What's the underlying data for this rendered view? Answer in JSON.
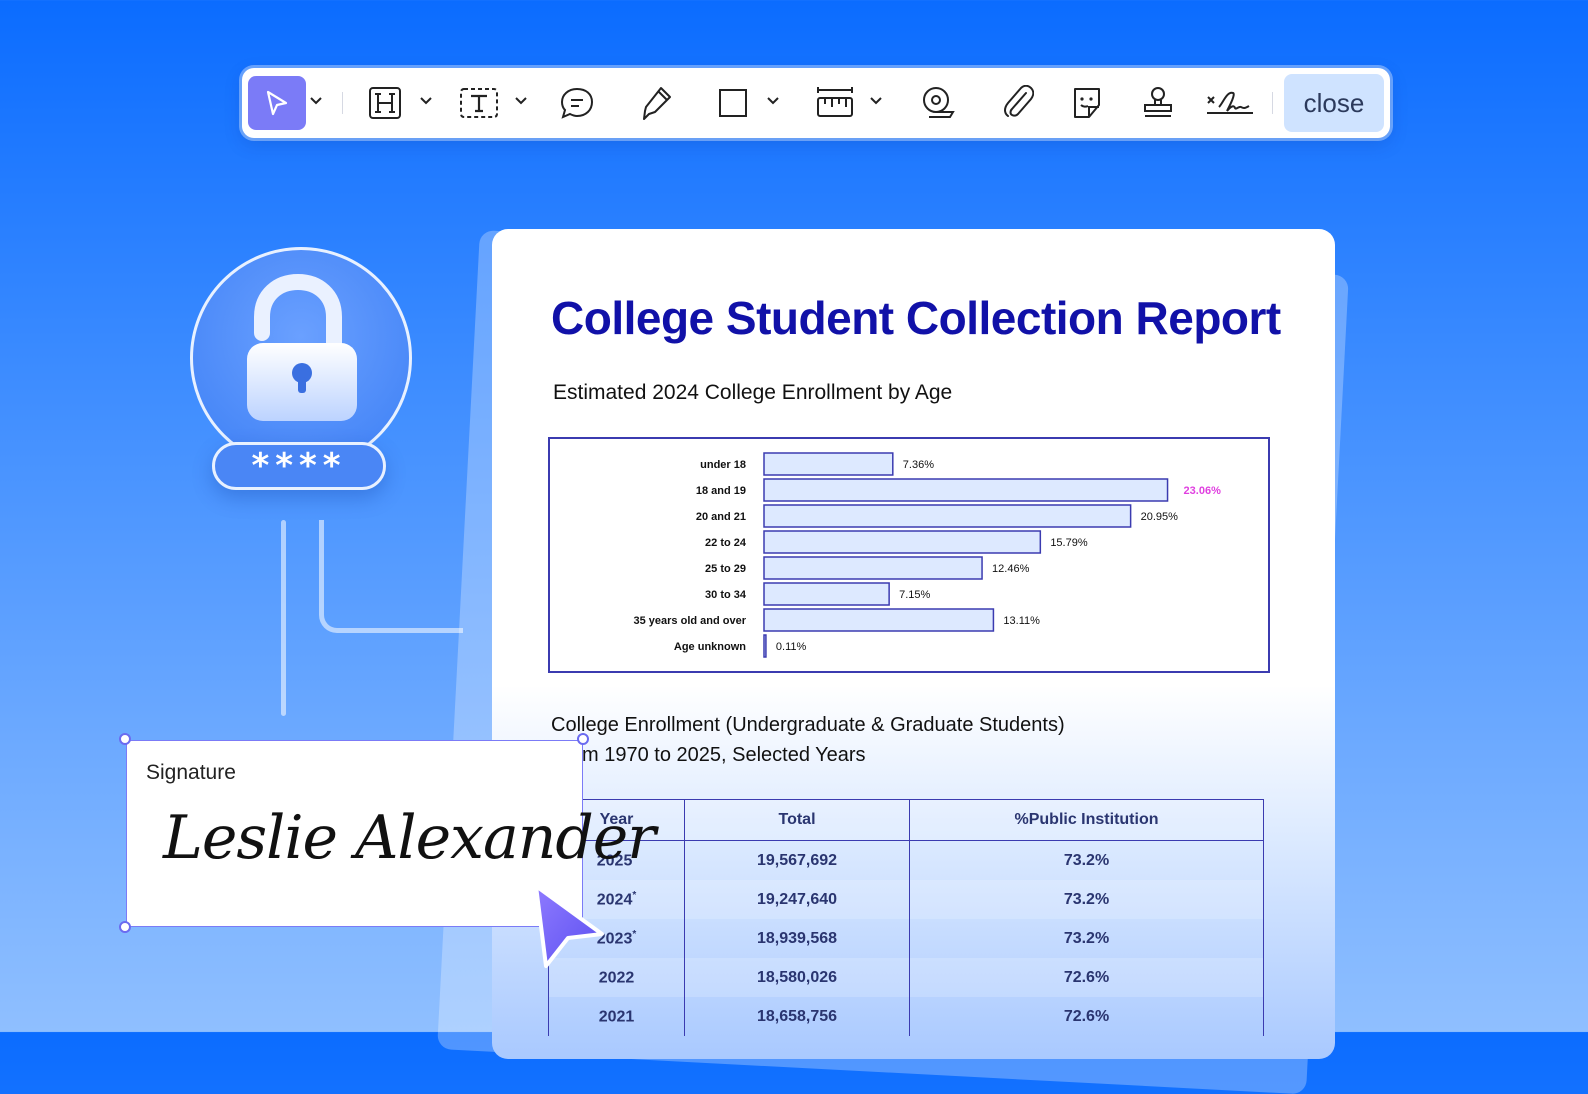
{
  "toolbar": {
    "tools": [
      "select-tool",
      "heading-tool",
      "text-tool",
      "comment-tool",
      "pen-tool",
      "shape-tool",
      "measure-tool",
      "tape-tool",
      "attach-tool",
      "sticker-tool",
      "stamp-tool",
      "signature-tool"
    ],
    "close_label": "close",
    "accent": "#7b7bf7"
  },
  "lock": {
    "password_mask": "****"
  },
  "document": {
    "title": "College Student Collection Report",
    "chart_title": "Estimated 2024 College Enrollment by Age",
    "table_title_line1": "College Enrollment (Undergraduate & Graduate Students)",
    "table_title_line2": "m 1970 to 2025, Selected Years",
    "table": {
      "headers": [
        "Year",
        "Total",
        "%Public Institution"
      ],
      "rows": [
        {
          "year": "2025",
          "star": "*",
          "total": "19,567,692",
          "pct": "73.2%"
        },
        {
          "year": "2024",
          "star": "*",
          "total": "19,247,640",
          "pct": "73.2%"
        },
        {
          "year": "2023",
          "star": "*",
          "total": "18,939,568",
          "pct": "73.2%"
        },
        {
          "year": "2022",
          "star": "",
          "total": "18,580,026",
          "pct": "72.6%"
        },
        {
          "year": "2021",
          "star": "",
          "total": "18,658,756",
          "pct": "72.6%"
        }
      ]
    }
  },
  "chart_data": {
    "type": "bar",
    "orientation": "horizontal",
    "categories": [
      "under 18",
      "18 and 19",
      "20 and 21",
      "22 to 24",
      "25 to 29",
      "30 to 34",
      "35 years old and over",
      "Age unknown"
    ],
    "values": [
      7.36,
      23.06,
      20.95,
      15.79,
      12.46,
      7.15,
      13.11,
      0.11
    ],
    "labels": [
      "7.36%",
      "23.06%",
      "20.95%",
      "15.79%",
      "12.46%",
      "7.15%",
      "13.11%",
      "0.11%"
    ],
    "highlight_index": 1,
    "highlight_color": "#e040e0",
    "bar_fill": "#dde9ff",
    "bar_stroke": "#3b3bb0",
    "title": "Estimated 2024 College Enrollment by Age",
    "grid": false
  },
  "signature": {
    "label": "Signature",
    "name": "Leslie Alexander"
  }
}
